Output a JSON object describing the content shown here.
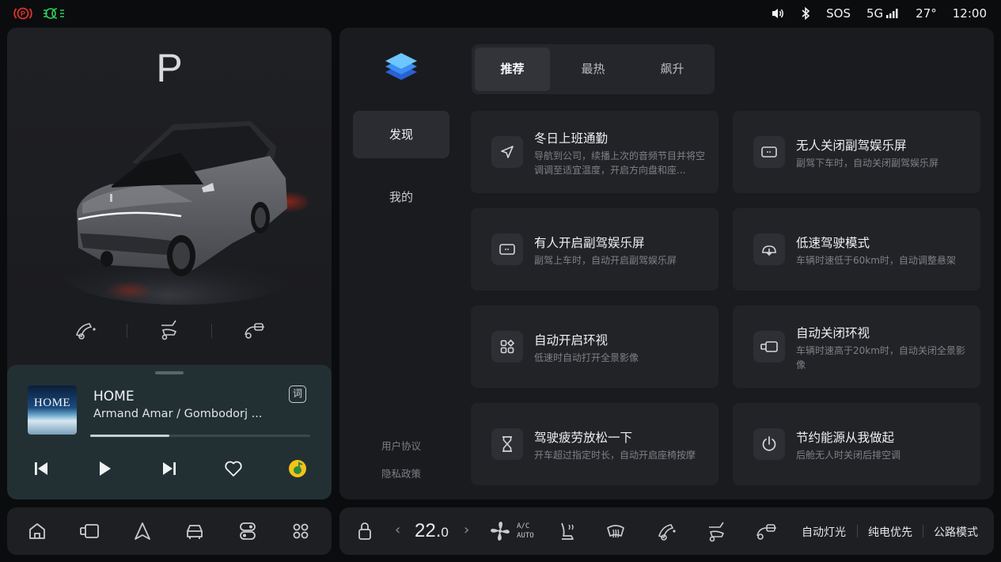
{
  "status_bar": {
    "sos": "SOS",
    "network": "5G",
    "temperature": "27°",
    "time": "12:00",
    "icons": [
      "brake-warning-icon",
      "parking-lights-icon",
      "volume-icon",
      "bluetooth-icon",
      "signal-icon"
    ],
    "colors": {
      "brake_warning": "#e0322d",
      "lights_indicator": "#2fcf5a"
    }
  },
  "vehicle": {
    "gear": "P",
    "modes": [
      "cabin-mode-1-icon",
      "cabin-mode-2-icon",
      "cabin-mode-3-icon"
    ]
  },
  "media": {
    "album_cover_text": "HOME",
    "title": "HOME",
    "artist": "Armand Amar / Gombodorj ...",
    "lyrics_label": "词",
    "progress": 0.36,
    "controls": [
      "previous-icon",
      "play-icon",
      "next-icon",
      "favorite-icon",
      "music-app-icon"
    ]
  },
  "left_dock": {
    "items": [
      "home-icon",
      "vehicle-control-icon",
      "navigation-icon",
      "car-icon",
      "toggles-icon",
      "apps-grid-icon"
    ]
  },
  "sidebar": {
    "tabs": [
      {
        "label": "发现",
        "active": true
      },
      {
        "label": "我的",
        "active": false
      }
    ],
    "links": [
      "用户协议",
      "隐私政策"
    ]
  },
  "segments": {
    "tabs": [
      {
        "label": "推荐",
        "active": true
      },
      {
        "label": "最热",
        "active": false
      },
      {
        "label": "飙升",
        "active": false
      }
    ]
  },
  "cards": [
    {
      "title": "冬日上班通勤",
      "desc": "导航到公司，续播上次的音频节目并将空调调至适宜温度，开启方向盘和座...",
      "icon": "navigation-arrow-icon"
    },
    {
      "title": "无人关闭副驾娱乐屏",
      "desc": "副驾下车时，自动关闭副驾娱乐屏",
      "icon": "passenger-screen-off-icon"
    },
    {
      "title": "有人开启副驾娱乐屏",
      "desc": "副驾上车时，自动开启副驾娱乐屏",
      "icon": "passenger-screen-on-icon"
    },
    {
      "title": "低速驾驶模式",
      "desc": "车辆时速低于60km时，自动调整悬架",
      "icon": "suspension-icon"
    },
    {
      "title": "自动开启环视",
      "desc": "低速时自动打开全景影像",
      "icon": "surround-view-icon"
    },
    {
      "title": "自动关闭环视",
      "desc": "车辆时速高于20km时，自动关闭全景影像",
      "icon": "camera-off-icon"
    },
    {
      "title": "驾驶疲劳放松一下",
      "desc": "开车超过指定时长，自动开启座椅按摩",
      "icon": "hourglass-icon"
    },
    {
      "title": "节约能源从我做起",
      "desc": "后舱无人时关闭后排空调",
      "icon": "power-icon"
    }
  ],
  "climate_dock": {
    "temperature": "22.",
    "temperature_decimal": "0",
    "left_arrow": "‹",
    "right_arrow": "›",
    "ac_line1": "A/C",
    "ac_line2": "AUTO",
    "lock_icon": "lock-icon",
    "quick_toggles": [
      "fan-icon",
      "seat-heat-icon",
      "defrost-icon",
      "seat-mode-1-icon",
      "seat-mode-2-icon",
      "seat-mode-3-icon"
    ],
    "text_toggles": [
      "自动灯光",
      "纯电优先",
      "公路模式"
    ]
  }
}
